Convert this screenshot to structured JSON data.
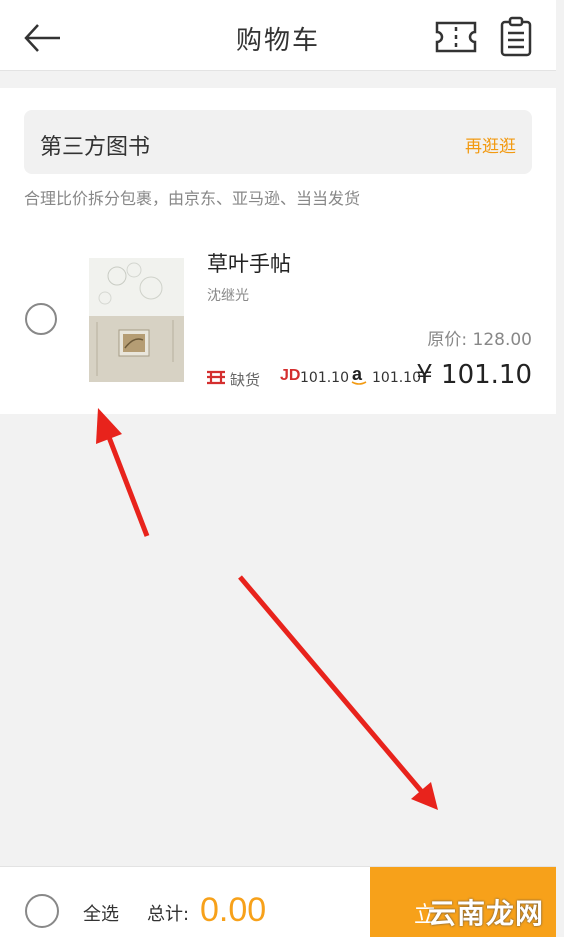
{
  "header": {
    "title": "购物车",
    "back_icon": "arrow-left-icon",
    "ticket_icon": "ticket-icon",
    "clipboard_icon": "clipboard-icon"
  },
  "shop": {
    "title": "第三方图书",
    "link": "再逛逛",
    "note": "合理比价拆分包裹，由京东、亚马逊、当当发货"
  },
  "item": {
    "title": "草叶手帖",
    "author": "沈继光",
    "original_price": "原价: 128.00",
    "dangdang_status": "缺货",
    "jd_logo": "JD",
    "jd_price": "101.10",
    "amazon_logo": "a",
    "amazon_price": "101.10",
    "sale_price": "¥ 101.10",
    "checked": false
  },
  "footer": {
    "select_all": "全选",
    "total_label": "总计:",
    "total_value": "0.00",
    "checkout_label": "立",
    "watermark": "云南龙网"
  },
  "colors": {
    "accent": "#f7a11a",
    "link": "#f29a12",
    "jd": "#d42f2f",
    "annotation_arrow": "#e8231c"
  }
}
